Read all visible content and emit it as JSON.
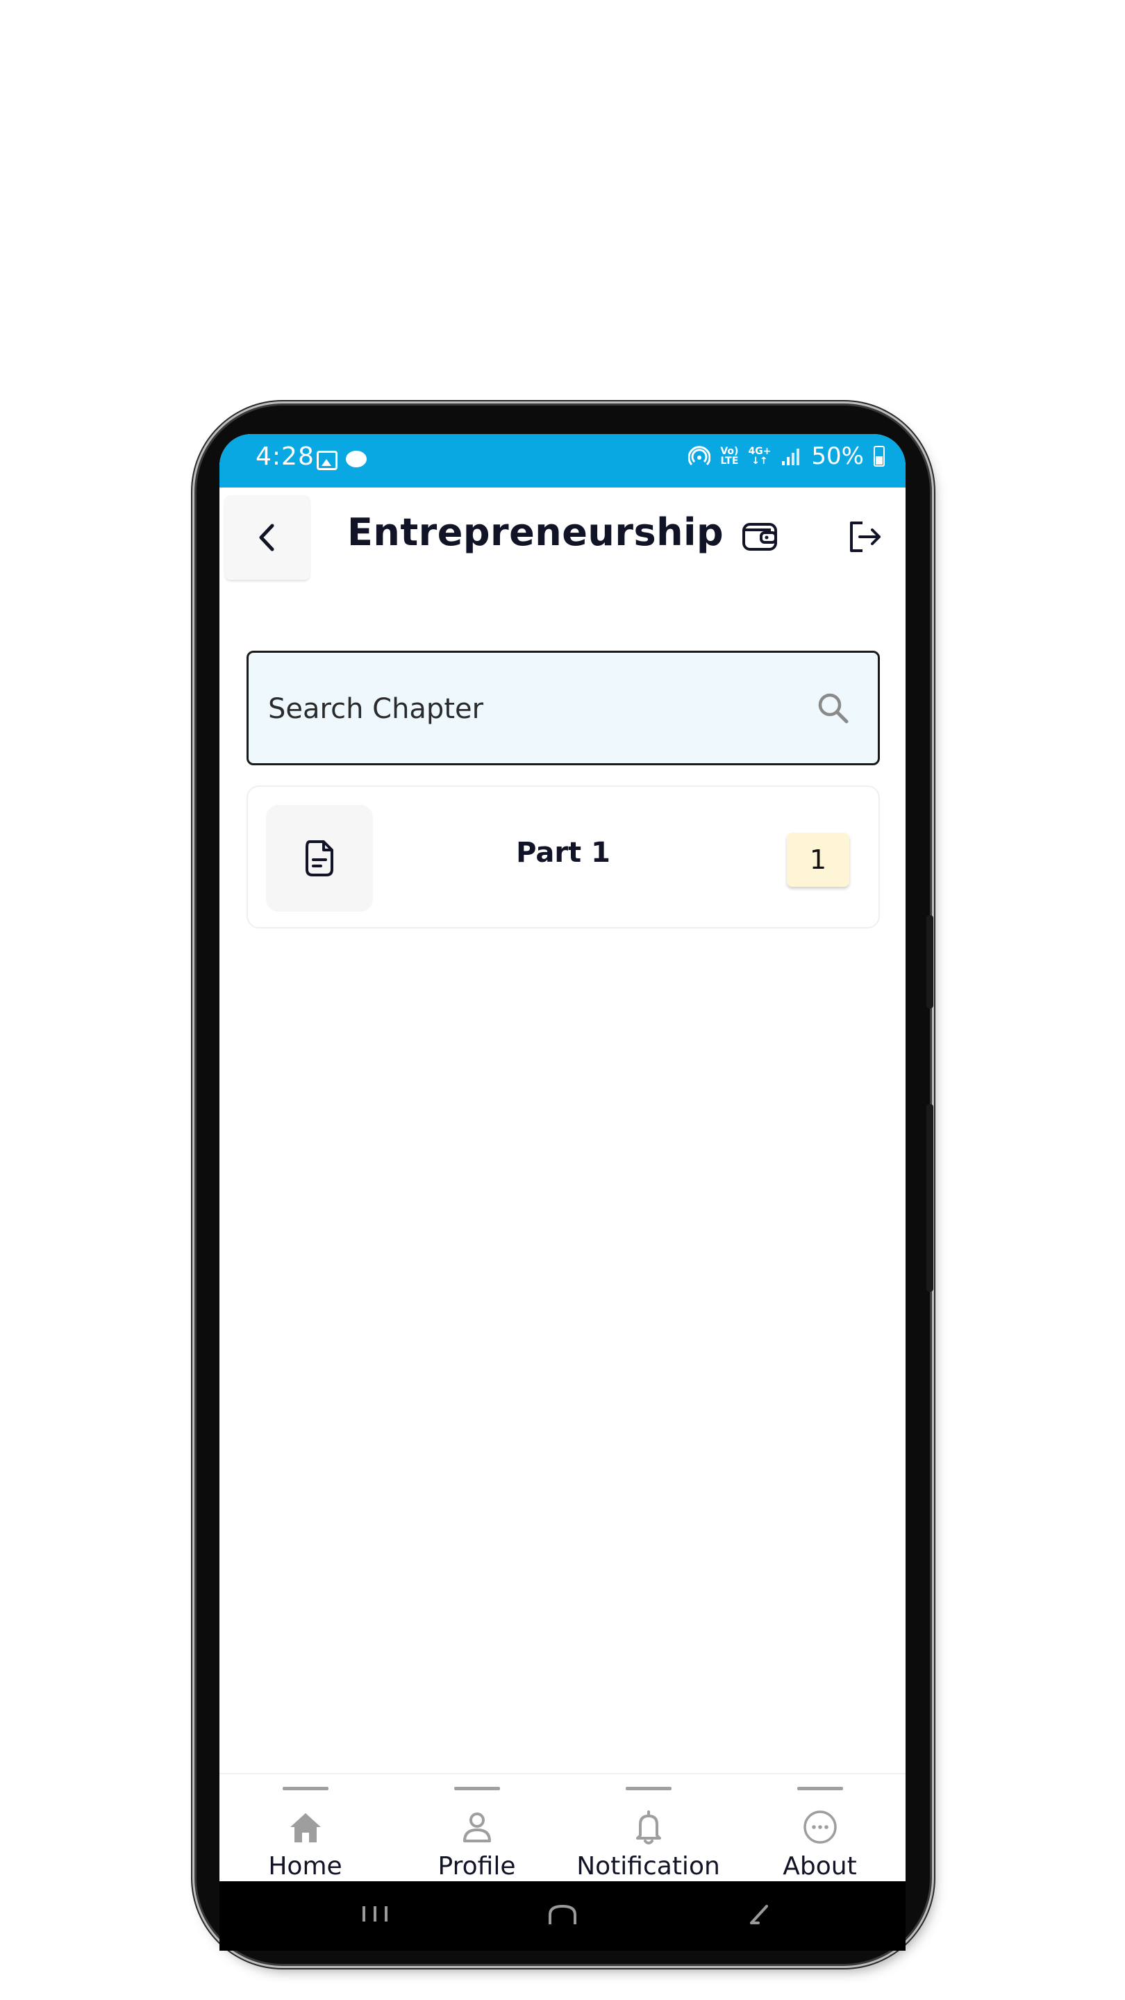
{
  "status_bar": {
    "time": "4:28",
    "network_top": "Vo)",
    "network_bottom": "LTE",
    "net_gen_top": "4G+",
    "net_gen_bottom": "↓↑",
    "battery": "50%"
  },
  "header": {
    "title": "Entrepreneurship",
    "back_icon": "chevron-left-icon",
    "wallet_icon": "wallet-icon",
    "logout_icon": "logout-icon"
  },
  "search": {
    "placeholder": "Search Chapter",
    "value": ""
  },
  "chapters": [
    {
      "title": "Part 1",
      "badge": "1",
      "icon": "document-icon"
    }
  ],
  "bottom_nav": {
    "items": [
      {
        "label": "Home",
        "icon": "home-icon"
      },
      {
        "label": "Profile",
        "icon": "user-icon"
      },
      {
        "label": "Notification",
        "icon": "bell-icon"
      },
      {
        "label": "About",
        "icon": "more-circle-icon"
      }
    ]
  },
  "colors": {
    "status_bar": "#0aa8e3",
    "search_bg": "#eff8fc",
    "badge_bg": "#fdf5d6",
    "nav_icon": "#9e9e9e"
  }
}
